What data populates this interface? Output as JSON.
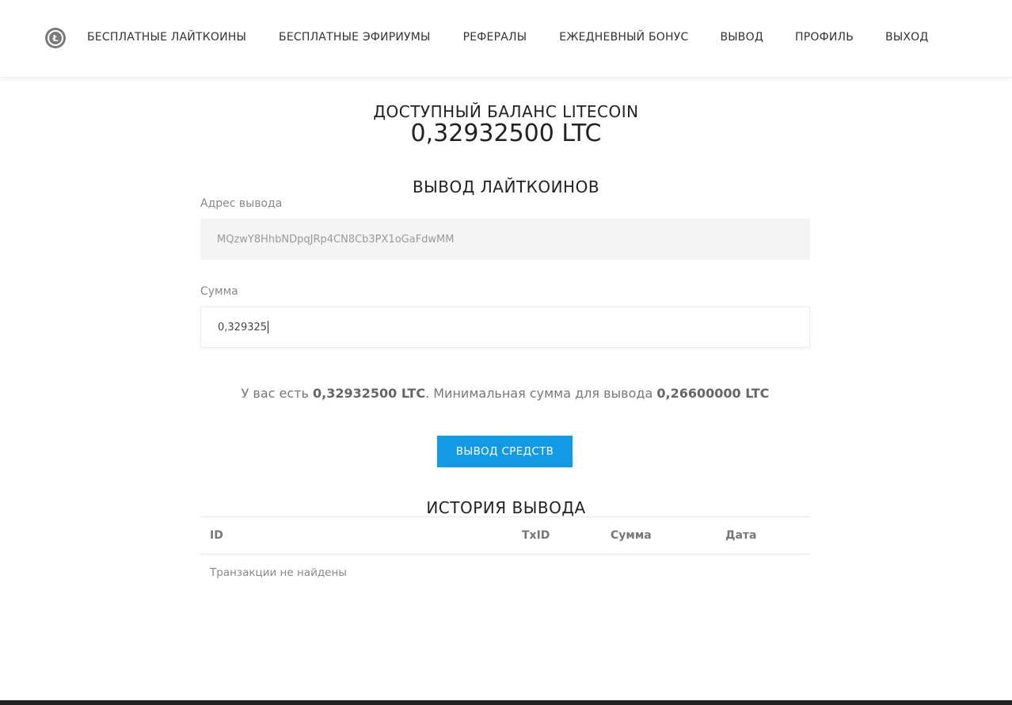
{
  "nav": {
    "logo_letter": "Ł",
    "items": [
      {
        "label": "БЕСПЛАТНЫЕ ЛАЙТКОИНЫ"
      },
      {
        "label": "БЕСПЛАТНЫЕ ЭФИРИУМЫ"
      },
      {
        "label": "РЕФЕРАЛЫ"
      },
      {
        "label": "ЕЖЕДНЕВНЫЙ БОНУС"
      },
      {
        "label": "ВЫВОД"
      },
      {
        "label": "ПРОФИЛЬ"
      },
      {
        "label": "ВЫХОД"
      }
    ]
  },
  "balance": {
    "label": "ДОСТУПНЫЙ БАЛАНС LITECOIN",
    "value": "0,32932500 LTC"
  },
  "withdraw": {
    "title": "ВЫВОД ЛАЙТКОИНОВ",
    "address_label": "Адрес вывода",
    "address_value": "MQzwY8HhbNDpqJRp4CN8Cb3PX1oGaFdwMM",
    "amount_label": "Сумма",
    "amount_value": "0,329325",
    "info_prefix": "У вас есть ",
    "info_balance": "0,32932500 LTC",
    "info_middle": ". Минимальная сумма для вывода ",
    "info_min": "0,26600000 LTC",
    "submit_label": "ВЫВОД СРЕДСТВ"
  },
  "history": {
    "title": "ИСТОРИЯ ВЫВОДА",
    "columns": [
      "ID",
      "TxID",
      "Сумма",
      "Дата"
    ],
    "empty_text": "Транзакции не найдены"
  },
  "colors": {
    "accent": "#139ae4",
    "footer": "#222222"
  }
}
